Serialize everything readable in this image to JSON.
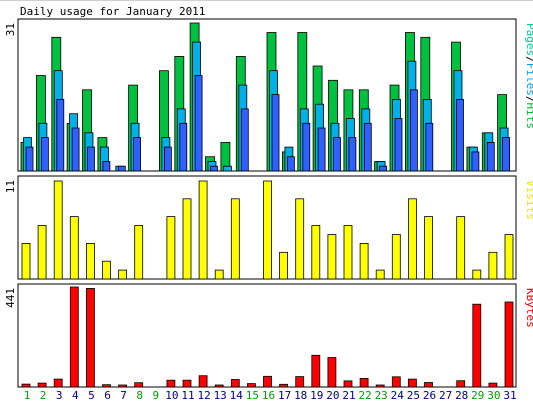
{
  "chart_data": [
    {
      "type": "bar",
      "title": "Daily usage for January 2011",
      "panel": "pages-files-hits",
      "ymax_label": "31",
      "legend": [
        "Pages",
        "/",
        "Files",
        "/",
        "Hits"
      ],
      "legend_colors": [
        "#00cc99",
        "#000000",
        "#00a0e0",
        "#000000",
        "#00bb33"
      ],
      "series": [
        {
          "name": "Hits",
          "color": "#00c040",
          "values": [
            6,
            20,
            28,
            10,
            17,
            7,
            0,
            18,
            0,
            21,
            24,
            31,
            3,
            6,
            24,
            0,
            29,
            4,
            29,
            22,
            19,
            17,
            17,
            2,
            18,
            29,
            28,
            0,
            27,
            5,
            8,
            16
          ]
        },
        {
          "name": "Files",
          "color": "#00b0e8",
          "values": [
            7,
            10,
            21,
            12,
            8,
            5,
            1,
            10,
            0,
            7,
            13,
            27,
            2,
            1,
            18,
            0,
            21,
            5,
            13,
            14,
            10,
            11,
            13,
            2,
            15,
            23,
            15,
            0,
            21,
            5,
            8,
            9
          ]
        },
        {
          "name": "Pages",
          "color": "#3060ff",
          "values": [
            5,
            7,
            15,
            9,
            5,
            2,
            1,
            7,
            0,
            5,
            10,
            20,
            1,
            0,
            13,
            0,
            16,
            3,
            10,
            9,
            7,
            7,
            10,
            1,
            11,
            17,
            10,
            0,
            15,
            4,
            6,
            7
          ]
        }
      ]
    },
    {
      "type": "bar",
      "panel": "visits",
      "ymax_label": "11",
      "legend": [
        "Visits"
      ],
      "legend_colors": [
        "#e8e800"
      ],
      "series": [
        {
          "name": "Visits",
          "color": "#ffff00",
          "values": [
            4,
            6,
            11,
            7,
            4,
            2,
            1,
            6,
            0,
            7,
            9,
            11,
            1,
            9,
            0,
            11,
            3,
            9,
            6,
            5,
            6,
            4,
            1,
            5,
            9,
            7,
            0,
            7,
            1,
            3,
            5
          ]
        }
      ]
    },
    {
      "type": "bar",
      "panel": "kbytes",
      "ymax_label": "441",
      "legend": [
        "KBytes"
      ],
      "legend_colors": [
        "#ee0000"
      ],
      "series": [
        {
          "name": "KBytes",
          "color": "#ff0000",
          "values": [
            13,
            17,
            35,
            441,
            435,
            10,
            5,
            19,
            0,
            30,
            30,
            50,
            8,
            33,
            15,
            47,
            12,
            46,
            140,
            130,
            27,
            38,
            5,
            45,
            35,
            20,
            0,
            28,
            365,
            17,
            375
          ]
        }
      ]
    }
  ],
  "x_labels": [
    {
      "label": "1",
      "weekend": true
    },
    {
      "label": "2",
      "weekend": true
    },
    {
      "label": "3",
      "weekend": false
    },
    {
      "label": "4",
      "weekend": false
    },
    {
      "label": "5",
      "weekend": false
    },
    {
      "label": "6",
      "weekend": false
    },
    {
      "label": "7",
      "weekend": false
    },
    {
      "label": "8",
      "weekend": true
    },
    {
      "label": "9",
      "weekend": true
    },
    {
      "label": "10",
      "weekend": false
    },
    {
      "label": "11",
      "weekend": false
    },
    {
      "label": "12",
      "weekend": false
    },
    {
      "label": "13",
      "weekend": false
    },
    {
      "label": "14",
      "weekend": false
    },
    {
      "label": "15",
      "weekend": true
    },
    {
      "label": "16",
      "weekend": true
    },
    {
      "label": "17",
      "weekend": false
    },
    {
      "label": "18",
      "weekend": false
    },
    {
      "label": "19",
      "weekend": false
    },
    {
      "label": "20",
      "weekend": false
    },
    {
      "label": "21",
      "weekend": false
    },
    {
      "label": "22",
      "weekend": true
    },
    {
      "label": "23",
      "weekend": true
    },
    {
      "label": "24",
      "weekend": false
    },
    {
      "label": "25",
      "weekend": false
    },
    {
      "label": "26",
      "weekend": false
    },
    {
      "label": "27",
      "weekend": false
    },
    {
      "label": "28",
      "weekend": false
    },
    {
      "label": "29",
      "weekend": true
    },
    {
      "label": "30",
      "weekend": true
    },
    {
      "label": "31",
      "weekend": false
    }
  ],
  "colors": {
    "weekday_label": "#000080",
    "weekend_label": "#00a000",
    "frame": "#000000"
  }
}
